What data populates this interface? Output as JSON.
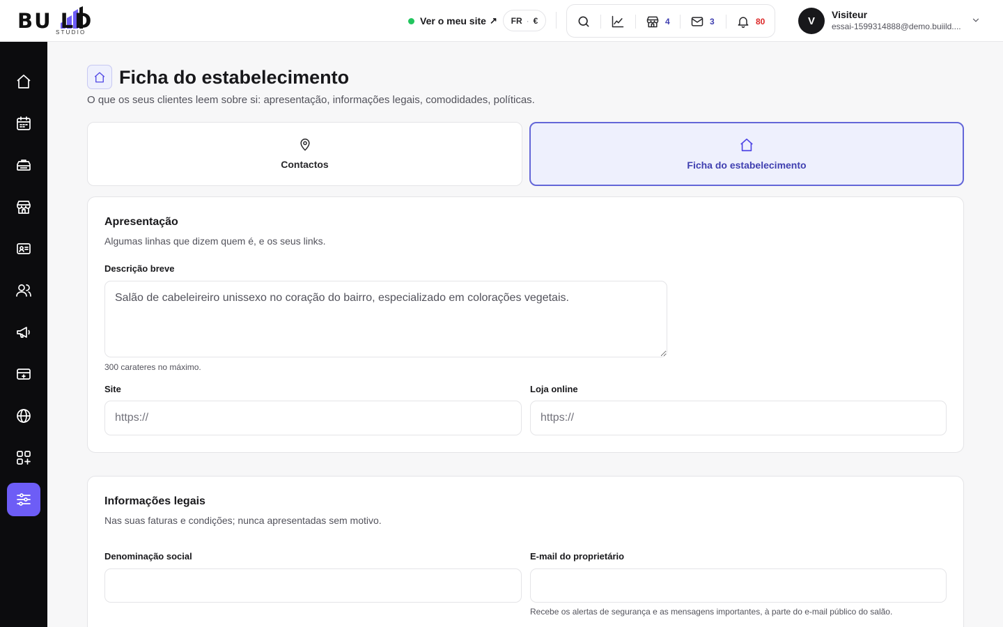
{
  "brand": {
    "name": "BU LD",
    "sub": "STUDIO"
  },
  "topbar": {
    "view_site": "Ver o meu site",
    "view_site_arrow": "↗",
    "lang": "FR",
    "currency": "€",
    "tools": [
      {
        "icon": "search-icon",
        "count": ""
      },
      {
        "icon": "analytics-icon",
        "count": ""
      },
      {
        "icon": "store-icon",
        "count": "4",
        "color": "#3f3fb0"
      },
      {
        "icon": "mail-icon",
        "count": "3",
        "color": "#3f3fb0"
      },
      {
        "icon": "bell-icon",
        "count": "80",
        "color": "#dc2626"
      }
    ]
  },
  "user": {
    "initial": "V",
    "name": "Visiteur",
    "email": "essai-1599314888@demo.buiild...."
  },
  "sidebar": {
    "items": [
      "home-icon",
      "calendar-icon",
      "services-icon",
      "store-icon",
      "contact-card-icon",
      "clients-icon",
      "megaphone-icon",
      "payment-icon",
      "globe-icon",
      "apps-icon",
      "settings-sliders-icon"
    ],
    "active": "settings-sliders-icon"
  },
  "page": {
    "title": "Ficha do estabelecimento",
    "subtitle": "O que os seus clientes leem sobre si: apresentação, informações legais, comodidades, políticas."
  },
  "tabs": [
    {
      "label": "Contactos",
      "icon": "location-pin-icon",
      "active": false
    },
    {
      "label": "Ficha do estabelecimento",
      "icon": "home-icon",
      "active": true
    }
  ],
  "presentation": {
    "title": "Apresentação",
    "subtitle": "Algumas linhas que dizem quem é, e os seus links.",
    "description_label": "Descrição breve",
    "description_value": "Salão de cabeleireiro unissexo no coração do bairro, especializado em colorações vegetais.",
    "description_hint": "300 carateres no máximo.",
    "site_label": "Site",
    "site_placeholder": "https://",
    "shop_label": "Loja online",
    "shop_placeholder": "https://"
  },
  "legal": {
    "title": "Informações legais",
    "subtitle": "Nas suas faturas e condições; nunca apresentadas sem motivo.",
    "company_label": "Denominação social",
    "company_value": "",
    "owner_email_label": "E-mail do proprietário",
    "owner_email_value": "",
    "owner_email_hint": "Recebe os alertas de segurança e as mensagens importantes, à parte do e-mail público do salão."
  },
  "colors": {
    "accent": "#6d5df6",
    "accent_text": "#3f3fb0",
    "online": "#22c55e",
    "alert": "#dc2626"
  }
}
